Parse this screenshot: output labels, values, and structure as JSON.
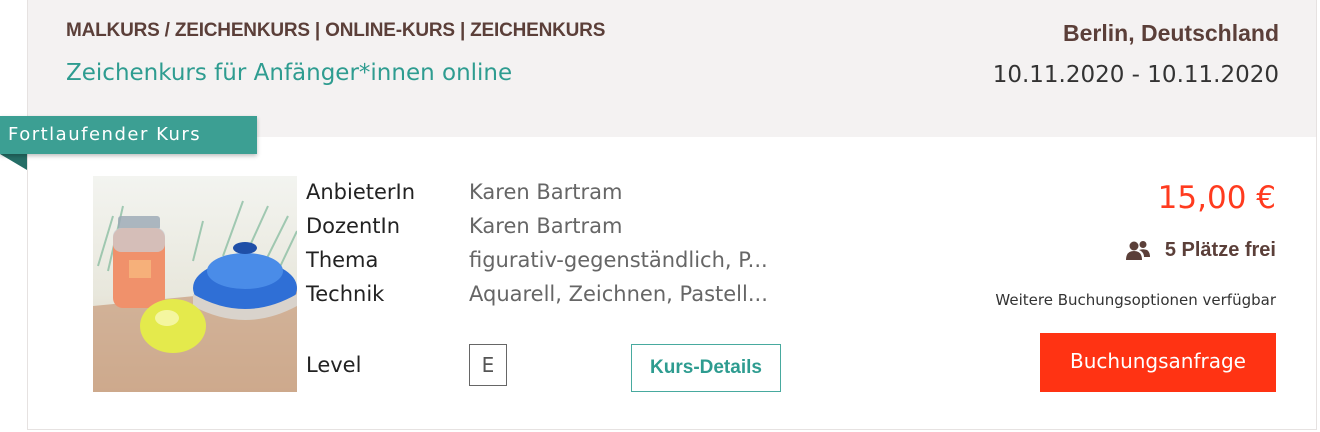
{
  "header": {
    "breadcrumb": "MALKURS / ZEICHENKURS | ONLINE-KURS | ZEICHENKURS",
    "title": "Zeichenkurs für Anfänger*innen online",
    "location": "Berlin, Deutschland",
    "dates": "10.11.2020 - 10.11.2020"
  },
  "ribbon": {
    "label": "Fortlaufender Kurs"
  },
  "thumbnail": {
    "icon": "course-painting-image"
  },
  "details": {
    "rows": [
      {
        "label": "AnbieterIn",
        "value": "Karen Bartram"
      },
      {
        "label": "DozentIn",
        "value": "Karen Bartram"
      },
      {
        "label": "Thema",
        "value": "figurativ-gegenständlich, P..."
      },
      {
        "label": "Technik",
        "value": "Aquarell, Zeichnen, Pastell..."
      }
    ],
    "level_label": "Level",
    "level_value": "E",
    "details_button": "Kurs-Details"
  },
  "booking": {
    "price": "15,00 €",
    "seats": "5 Plätze frei",
    "seats_icon": "people-icon",
    "options_text": "Weitere Buchungsoptionen verfügbar",
    "button": "Buchungsanfrage"
  },
  "colors": {
    "accent_teal": "#2e9c90",
    "price_red": "#ff3b1f",
    "button_red": "#ff3313",
    "heading_brown": "#5b3f39"
  }
}
